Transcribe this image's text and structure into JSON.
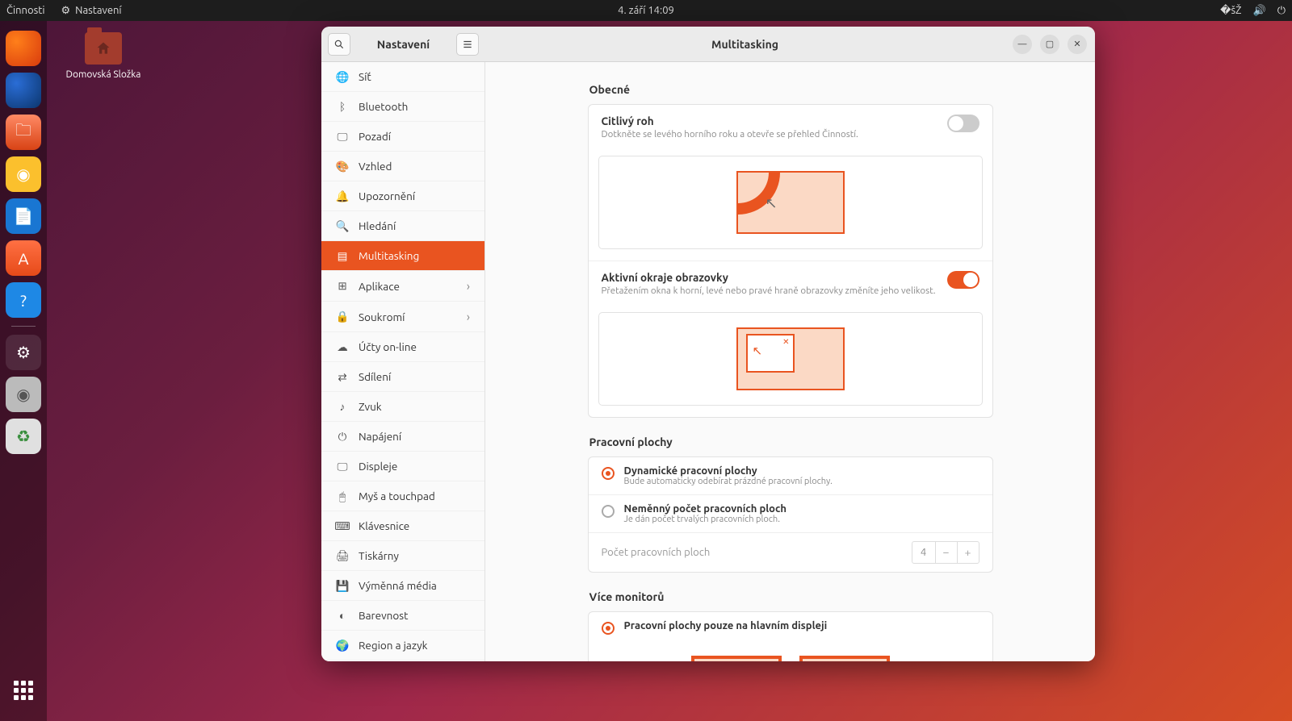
{
  "top_panel": {
    "activities": "Činnosti",
    "app_indicator": "Nastavení",
    "datetime": "4. září  14:09"
  },
  "desktop": {
    "home_folder": "Domovská Složka"
  },
  "window": {
    "sidebar_title": "Nastavení",
    "header_title": "Multitasking"
  },
  "sidebar": {
    "items": [
      {
        "label": "Síť"
      },
      {
        "label": "Bluetooth"
      },
      {
        "label": "Pozadí"
      },
      {
        "label": "Vzhled"
      },
      {
        "label": "Upozornění"
      },
      {
        "label": "Hledání"
      },
      {
        "label": "Multitasking"
      },
      {
        "label": "Aplikace"
      },
      {
        "label": "Soukromí"
      },
      {
        "label": "Účty on-line"
      },
      {
        "label": "Sdílení"
      },
      {
        "label": "Zvuk"
      },
      {
        "label": "Napájení"
      },
      {
        "label": "Displeje"
      },
      {
        "label": "Myš a touchpad"
      },
      {
        "label": "Klávesnice"
      },
      {
        "label": "Tiskárny"
      },
      {
        "label": "Výměnná média"
      },
      {
        "label": "Barevnost"
      },
      {
        "label": "Region a jazyk"
      }
    ]
  },
  "content": {
    "general": {
      "title": "Obecné",
      "hot_corner": {
        "title": "Citlivý roh",
        "desc": "Dotkněte se levého horního roku a otevře se přehled Činností.",
        "enabled": false
      },
      "screen_edges": {
        "title": "Aktivní okraje obrazovky",
        "desc": "Přetažením okna k horní, levé nebo pravé hraně obrazovky změníte jeho velikost.",
        "enabled": true
      }
    },
    "workspaces": {
      "title": "Pracovní plochy",
      "dynamic": {
        "title": "Dynamické pracovní plochy",
        "desc": "Bude automaticky odebírat prázdné pracovní plochy."
      },
      "fixed": {
        "title": "Neměnný počet pracovních ploch",
        "desc": "Je dán počet trvalých pracovních ploch."
      },
      "mode": "dynamic",
      "count_label": "Počet pracovních ploch",
      "count_value": "4"
    },
    "monitors": {
      "title": "Více monitorů",
      "primary_only": {
        "label": "Pracovní plochy pouze na hlavním displeji"
      },
      "mode": "primary"
    }
  }
}
